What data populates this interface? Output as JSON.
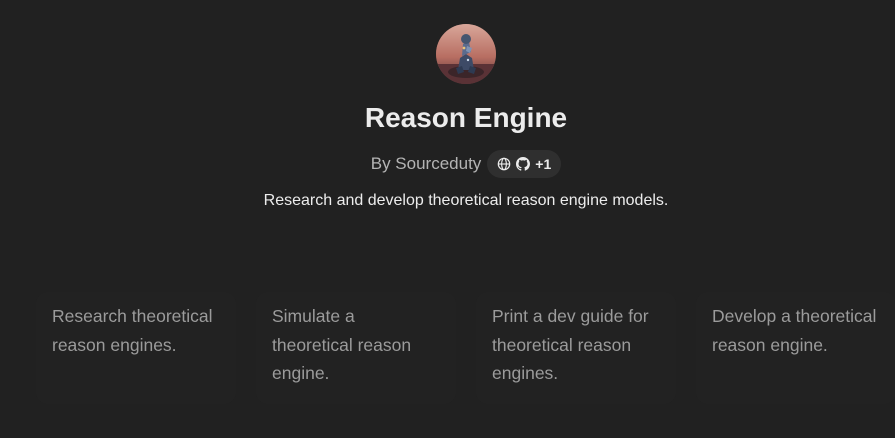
{
  "gpt": {
    "name": "Reason Engine",
    "author": "By Sourceduty",
    "link_count": "+1",
    "description": "Research and develop theoretical reason engine models.",
    "avatar_icon": "thinker-statue-avatar",
    "link_icons": [
      "globe-icon",
      "github-icon"
    ]
  },
  "conversation_starters": [
    {
      "label": "Research theoretical reason engines."
    },
    {
      "label": "Simulate a theoretical reason engine."
    },
    {
      "label": "Print a dev guide for theoretical reason engines."
    },
    {
      "label": "Develop a theoretical reason engine."
    }
  ],
  "colors": {
    "background": "#212121",
    "card_background": "#222222",
    "pill_background": "#2f2f2f",
    "primary_text": "#ececec",
    "secondary_text": "#b4b4b4",
    "starter_text": "#9b9b9b"
  }
}
